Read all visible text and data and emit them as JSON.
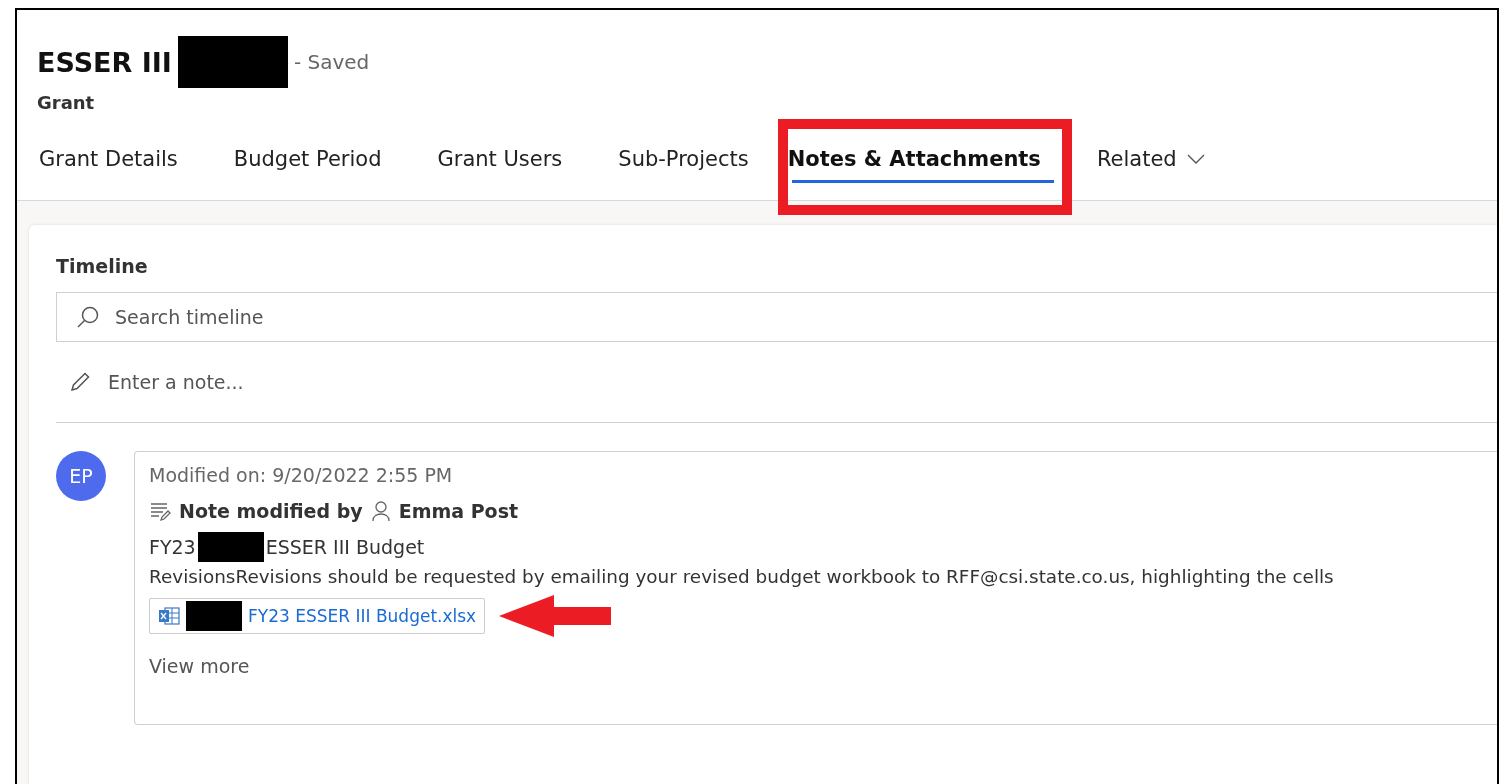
{
  "record": {
    "title": "ESSER III",
    "status": "- Saved",
    "entity": "Grant"
  },
  "tabs": [
    {
      "label": "Grant Details",
      "selected": false
    },
    {
      "label": "Budget Period",
      "selected": false
    },
    {
      "label": "Grant Users",
      "selected": false
    },
    {
      "label": "Sub-Projects",
      "selected": false
    },
    {
      "label": "Notes & Attachments",
      "selected": true,
      "highlighted": true
    },
    {
      "label": "Related",
      "selected": false,
      "kind": "dropdown"
    }
  ],
  "timeline": {
    "title": "Timeline",
    "search": {
      "placeholder": "Search timeline"
    },
    "note": {
      "placeholder": "Enter a note..."
    },
    "entries": [
      {
        "avatar": "EP",
        "modified": "Modified on: 9/20/2022 2:55 PM",
        "action": "Note modified by",
        "author": "Emma Post",
        "subject_start": "FY23",
        "subject_end": "ESSER III Budget",
        "body": "RevisionsRevisions should be requested by emailing your revised budget workbook to RFF@csi.state.co.us, highlighting the cells",
        "attachment": {
          "name": "FY23 ESSER III Budget.xlsx",
          "pointed": true
        },
        "more": "View more"
      }
    ]
  }
}
